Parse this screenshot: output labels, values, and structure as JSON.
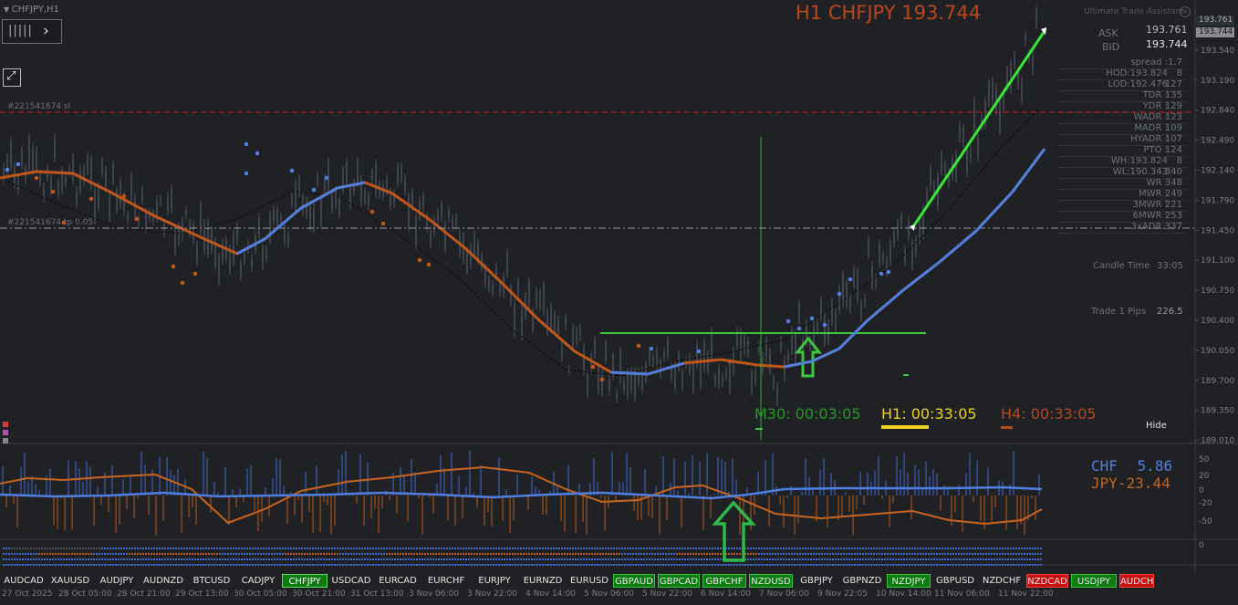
{
  "window": {
    "title": "CHFJPY,H1",
    "trade_label": "#221541674 sl",
    "trade_label2": "#221541674 tp 0.05"
  },
  "header": {
    "quote_title": "H1 CHFJPY 193.744"
  },
  "panel": {
    "title": "Ultimate Trade Assistant",
    "ask_label": "ASK",
    "ask_value": "193.761",
    "bid_label": "BID",
    "bid_value": "193.744",
    "rows": [
      {
        "label": "spread :",
        "value": "1.7"
      },
      {
        "label": "HOD:193.824",
        "value": "8"
      },
      {
        "label": "LOD:192.476",
        "value": "127"
      },
      {
        "label": "TDR :",
        "value": "135"
      },
      {
        "label": "YDR :",
        "value": "129"
      },
      {
        "label": "WADR :",
        "value": "123"
      },
      {
        "label": "MADR :",
        "value": "109"
      },
      {
        "label": "HYADR :",
        "value": "107"
      },
      {
        "label": "PTO :",
        "value": "124"
      },
      {
        "label": "WH:193.824",
        "value": "8"
      },
      {
        "label": "WL:190.343",
        "value": "340"
      },
      {
        "label": "WR :",
        "value": "348"
      },
      {
        "label": "MWR :",
        "value": "249"
      },
      {
        "label": "3MWR :",
        "value": "221"
      },
      {
        "label": "6MWR :",
        "value": "253"
      },
      {
        "label": "3xADR :",
        "value": "337"
      }
    ],
    "candle_time_label": "Candle Time",
    "candle_time_value": "33:05",
    "trade_pips_label": "Trade 1 Pips",
    "trade_pips_value": "226.5"
  },
  "timers": {
    "m30": "M30: 00:03:05",
    "h1": "H1: 00:33:05",
    "h4": "H4: 00:33:05",
    "hide": "Hide"
  },
  "price_axis": [
    "193.820",
    "193.540",
    "193.190",
    "192.840",
    "192.490",
    "192.140",
    "191.790",
    "191.450",
    "191.100",
    "190.750",
    "190.400",
    "190.050",
    "189.700",
    "189.350",
    "189.010"
  ],
  "price_tags": {
    "ask": "193.761",
    "bid": "193.744"
  },
  "indicator": {
    "chf_label": "CHF",
    "chf_value": "5.86",
    "jpy_label": "JPY",
    "jpy_value": "-23.44",
    "axis": [
      "50",
      "20",
      "0",
      "-20",
      "-50",
      "0"
    ]
  },
  "symbols": [
    {
      "name": "AUDCAD",
      "style": "plain"
    },
    {
      "name": "XAUUSD",
      "style": "plain"
    },
    {
      "name": "AUDJPY",
      "style": "plain"
    },
    {
      "name": "AUDNZD",
      "style": "plain"
    },
    {
      "name": "BTCUSD",
      "style": "plain"
    },
    {
      "name": "CADJPY",
      "style": "plain"
    },
    {
      "name": "CHFJPY",
      "style": "active"
    },
    {
      "name": "USDCAD",
      "style": "plain"
    },
    {
      "name": "EURCAD",
      "style": "plain"
    },
    {
      "name": "EURCHF",
      "style": "plain"
    },
    {
      "name": "EURJPY",
      "style": "plain"
    },
    {
      "name": "EURNZD",
      "style": "plain"
    },
    {
      "name": "EURUSD",
      "style": "plain"
    },
    {
      "name": "GBPAUD",
      "style": "green"
    },
    {
      "name": "GBPCAD",
      "style": "green"
    },
    {
      "name": "GBPCHF",
      "style": "green"
    },
    {
      "name": "NZDUSD",
      "style": "green"
    },
    {
      "name": "GBPJPY",
      "style": "plain"
    },
    {
      "name": "GBPNZD",
      "style": "plain"
    },
    {
      "name": "NZDJPY",
      "style": "green"
    },
    {
      "name": "GBPUSD",
      "style": "plain"
    },
    {
      "name": "NZDCHF",
      "style": "plain"
    },
    {
      "name": "NZDCAD",
      "style": "red"
    },
    {
      "name": "USDJPY",
      "style": "green"
    },
    {
      "name": "AUDCH",
      "style": "red"
    }
  ],
  "time_axis": [
    "27 Oct 2025",
    "28 Oct 05:00",
    "28 Oct 21:00",
    "29 Oct 13:00",
    "30 Oct 05:00",
    "30 Oct 21:00",
    "31 Oct 13:00",
    "3 Nov 06:00",
    "3 Nov 22:00",
    "4 Nov 14:00",
    "5 Nov 06:00",
    "5 Nov 22:00",
    "6 Nov 14:00",
    "7 Nov 06:00",
    "9 Nov 22:05",
    "10 Nov 14:00",
    "11 Nov 06:00",
    "11 Nov 22:00"
  ],
  "colors": {
    "background": "#202124",
    "ma_blue": "#4f7fe0",
    "ma_orange": "#c0561a",
    "sl_red": "#d42222",
    "trend_green": "#36e036",
    "chf": "#4f7fe0",
    "jpy": "#c8641e"
  }
}
